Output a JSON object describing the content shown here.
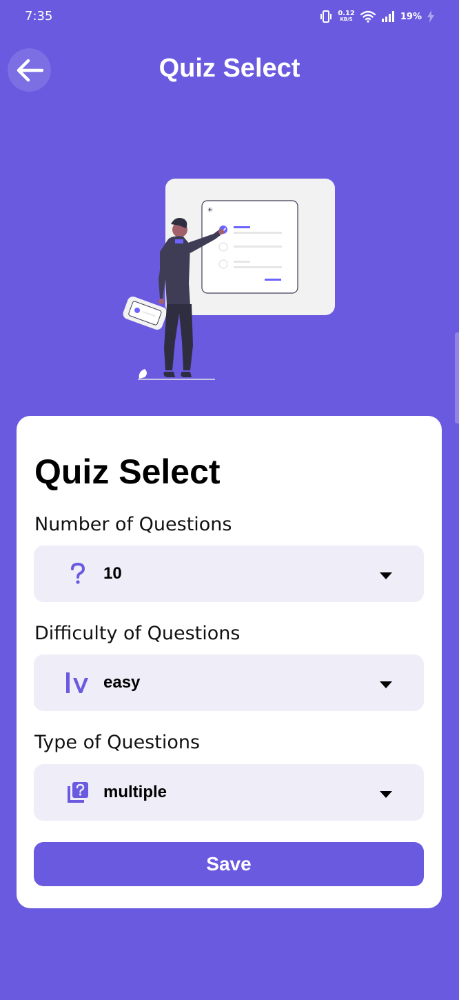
{
  "status_bar": {
    "time": "7:35",
    "net_speed_value": "0.12",
    "net_speed_unit": "KB/S",
    "battery": "19%"
  },
  "header": {
    "title": "Quiz Select",
    "back_icon": "arrow-left-icon"
  },
  "card": {
    "title": "Quiz Select",
    "fields": [
      {
        "label": "Number of Questions",
        "value": "10",
        "icon": "question-mark-icon"
      },
      {
        "label": "Difficulty of Questions",
        "value": "easy",
        "icon": "level-icon"
      },
      {
        "label": "Type of Questions",
        "value": "multiple",
        "icon": "quiz-library-icon"
      }
    ],
    "save_label": "Save"
  },
  "colors": {
    "primary": "#6A5AE0",
    "card_background": "#FFFFFF",
    "dropdown_background": "#EEEDF8"
  }
}
